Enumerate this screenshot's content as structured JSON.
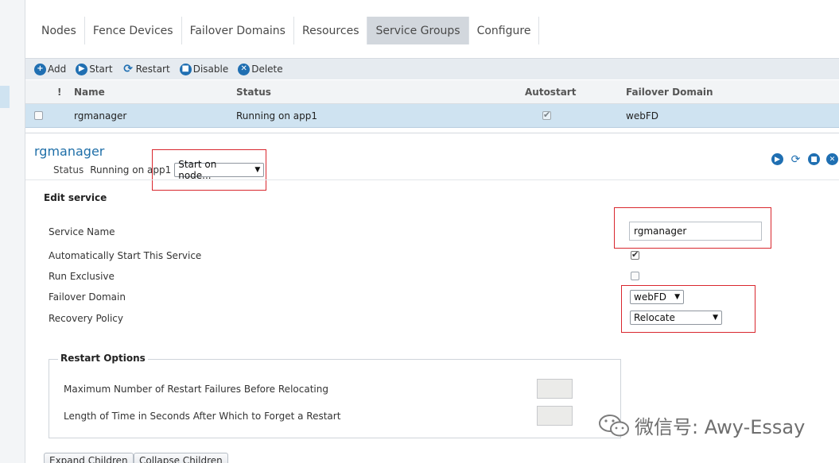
{
  "tabs": [
    "Nodes",
    "Fence Devices",
    "Failover Domains",
    "Resources",
    "Service Groups",
    "Configure"
  ],
  "active_tab": "Service Groups",
  "toolbar": {
    "add": "Add",
    "start": "Start",
    "restart": "Restart",
    "disable": "Disable",
    "delete": "Delete"
  },
  "table": {
    "headers": {
      "flag": "!",
      "name": "Name",
      "status": "Status",
      "autostart": "Autostart",
      "failover_domain": "Failover Domain"
    },
    "rows": [
      {
        "name": "rgmanager",
        "status": "Running on app1",
        "autostart": true,
        "failover_domain": "webFD"
      }
    ]
  },
  "service": {
    "title": "rgmanager",
    "status_label": "Status",
    "status_value": "Running on app1",
    "start_on_node": "Start on node..."
  },
  "edit": {
    "title": "Edit service",
    "service_name_label": "Service Name",
    "service_name_value": "rgmanager",
    "autostart_label": "Automatically Start This Service",
    "autostart_checked": true,
    "exclusive_label": "Run Exclusive",
    "exclusive_checked": false,
    "failover_label": "Failover Domain",
    "failover_value": "webFD",
    "recovery_label": "Recovery Policy",
    "recovery_value": "Relocate"
  },
  "restart_options": {
    "legend": "Restart Options",
    "max_failures_label": "Maximum Number of Restart Failures Before Relocating",
    "forget_label": "Length of Time in Seconds After Which to Forget a Restart"
  },
  "buttons": {
    "expand": "Expand Children",
    "collapse": "Collapse Children"
  },
  "watermark": "微信号: Awy-Essay",
  "colors": {
    "accent": "#1f6fb2",
    "selected_row": "#cfe3f1",
    "highlight": "#d9272e"
  },
  "icons": {
    "add": "plus-circle-icon",
    "start": "play-circle-icon",
    "restart": "refresh-icon",
    "disable": "stop-circle-icon",
    "delete": "x-circle-icon",
    "watermark": "wechat-icon"
  }
}
